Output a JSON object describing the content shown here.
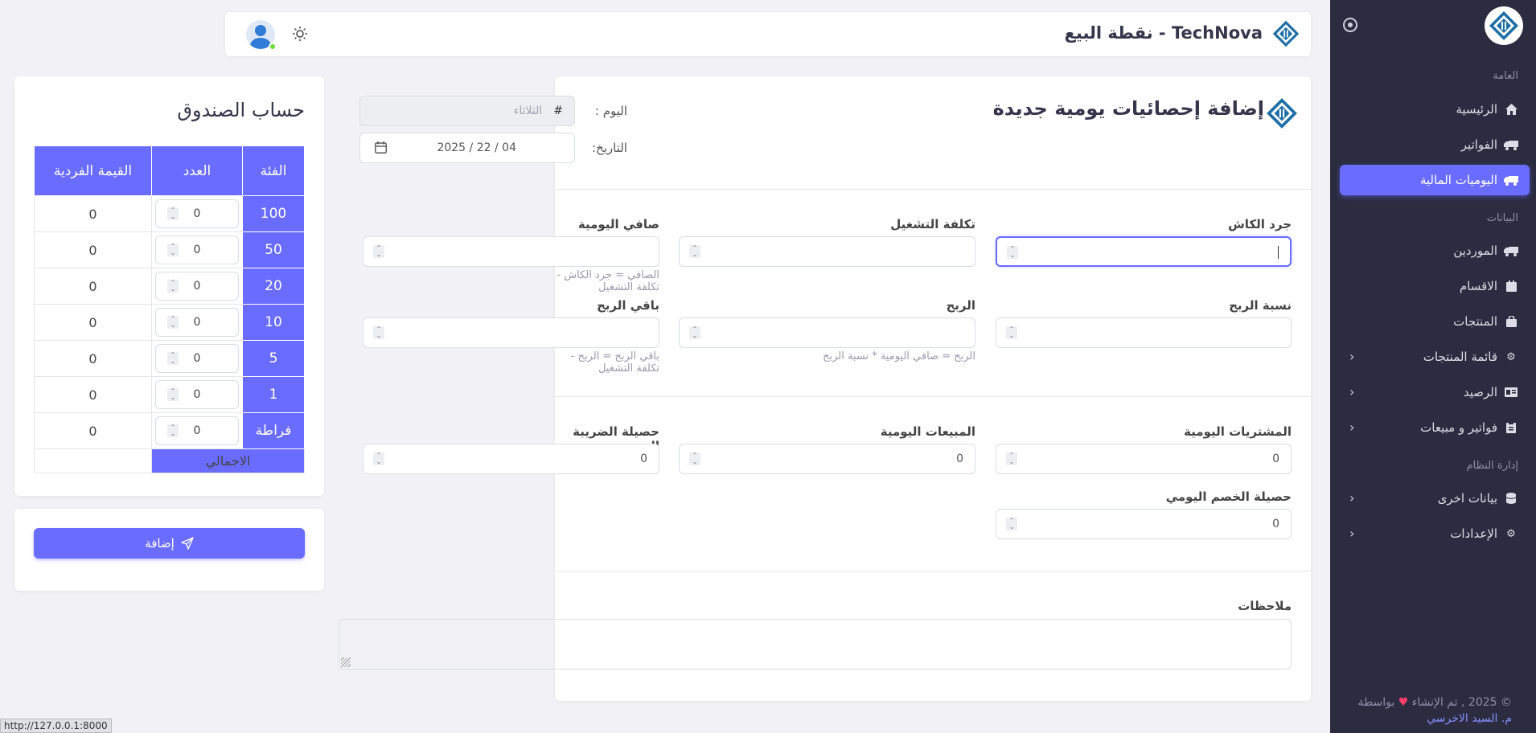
{
  "app": {
    "title": "TechNova - نقطة البيع",
    "status_url": "http://127.0.0.1:8000"
  },
  "sidebar": {
    "sections": {
      "general": "العامة",
      "data": "البيانات",
      "system": "إدارة النظام"
    },
    "items": [
      {
        "label": "الرئيسية",
        "icon": "home-icon"
      },
      {
        "label": "الفواتير",
        "icon": "truck-icon"
      },
      {
        "label": "اليوميات المالية",
        "icon": "truck-icon",
        "active": true
      },
      {
        "label": "الموردين",
        "icon": "truck-icon"
      },
      {
        "label": "الاقسام",
        "icon": "calendar-icon"
      },
      {
        "label": "المنتجات",
        "icon": "bag-icon"
      },
      {
        "label": "قائمة المنتجات",
        "icon": "gear-icon"
      },
      {
        "label": "الرصيد",
        "icon": "id-card-icon"
      },
      {
        "label": "فواتير و مبيعات",
        "icon": "clipboard-icon"
      },
      {
        "label": "بيانات اخرى",
        "icon": "database-icon"
      },
      {
        "label": "الإعدادات",
        "icon": "gear-icon"
      }
    ],
    "footer": {
      "line1": "© 2025 , تم الإنشاء",
      "line1b": "بواسطة",
      "author": "م. السيد الاخرسي"
    }
  },
  "form": {
    "title": "إضافة إحصائيات يومية جديدة",
    "day_label": "اليوم :",
    "day_placeholder": "الثلاثاء",
    "day_prefix": "#",
    "date_label": "التاريخ:",
    "date_value": "04 / 22 / 2025",
    "cash_count_label": "جرد الكاش",
    "operating_cost_label": "تكلفة التشغيل",
    "daily_net_label": "صافي اليومية",
    "daily_net_hint": "الصافي = جرد الكاش - تكلفة التشغيل",
    "profit_ratio_label": "نسبة الربح",
    "profit_label": "الربح",
    "profit_hint": "الربح = صافي اليومية * نسبة الربح",
    "profit_remaining_label": "باقي الربح",
    "profit_remaining_hint": "باقي الربح = الربح - تكلفة التشغيل",
    "daily_purchases_label": "المشتريات اليومية",
    "daily_purchases_value": "0",
    "daily_sales_label": "المبيعات اليومية",
    "daily_sales_value": "0",
    "daily_tax_label": "حصيلة الضريبة اليومية",
    "daily_tax_value": "0",
    "daily_discount_label": "حصيلة الخصم اليومي",
    "daily_discount_value": "0",
    "notes_label": "ملاحظات"
  },
  "cash_box": {
    "title": "حساب الصندوق",
    "headers": {
      "category": "الفئة",
      "count": "العدد",
      "unit_value": "القيمة الفردية"
    },
    "rows": [
      {
        "denom": "100",
        "count": "0",
        "value": "0"
      },
      {
        "denom": "50",
        "count": "0",
        "value": "0"
      },
      {
        "denom": "20",
        "count": "0",
        "value": "0"
      },
      {
        "denom": "10",
        "count": "0",
        "value": "0"
      },
      {
        "denom": "5",
        "count": "0",
        "value": "0"
      },
      {
        "denom": "1",
        "count": "0",
        "value": "0"
      },
      {
        "denom": "فراطة",
        "count": "0",
        "value": "0"
      }
    ],
    "total_label": "الاجمالي"
  },
  "actions": {
    "add_label": "إضافة"
  },
  "colors": {
    "accent": "#696cff",
    "sidebar_bg": "#2b2c40",
    "page_bg": "#f2f2f6"
  }
}
